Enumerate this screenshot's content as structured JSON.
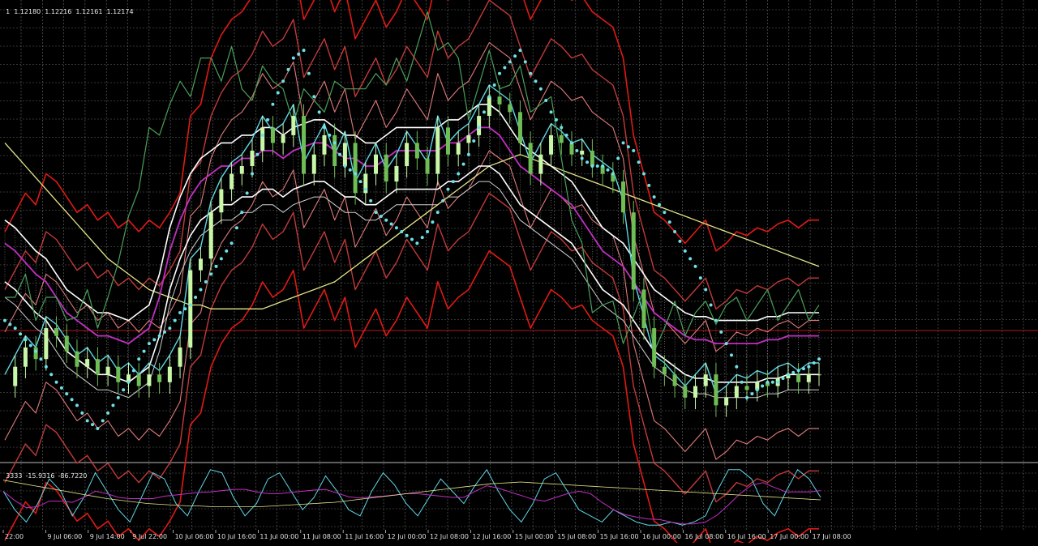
{
  "header": {
    "symbol_mark": "1",
    "ohlc": [
      "1.12180",
      "1.12216",
      "1.12161",
      "1.12174"
    ]
  },
  "oscillator_header": {
    "values": [
      "3333",
      "-15.9316",
      "-86.7220"
    ]
  },
  "colors": {
    "background": "#000000",
    "grid": "#6a6a6a",
    "price_line": "#b01818",
    "separator": "#bbbbbb",
    "candle": "#c9f7a8",
    "candle_dark": "#6fbd55",
    "bb_outer": "#e01a14",
    "bb_mid": "#c23a3a",
    "bb_light": "#e07a7a",
    "white_line": "#ffffff",
    "cyan_line": "#5fd6e6",
    "magenta_line": "#c22ec2",
    "yellow_line": "#e6e68a",
    "green_line": "#4aa05a",
    "psar": "#6fe0e8",
    "gray_line": "#cfcfcf"
  },
  "chart_data": {
    "type": "line",
    "chart_kind": "candlestick with overlay indicators (Bollinger bands, Ichimoku cloud, Parabolic SAR, moving averages) and an oscillator sub-panel",
    "x_tick_labels": [
      "22:00",
      "9 Jul 06:00",
      "9 Jul 14:00",
      "9 Jul 22:00",
      "10 Jul 06:00",
      "10 Jul 16:00",
      "11 Jul 00:00",
      "11 Jul 08:00",
      "11 Jul 16:00",
      "12 Jul 00:00",
      "12 Jul 08:00",
      "12 Jul 16:00",
      "15 Jul 00:00",
      "15 Jul 08:00",
      "15 Jul 16:00",
      "16 Jul 00:00",
      "16 Jul 08:00",
      "16 Jul 16:00",
      "17 Jul 00:00",
      "17 Jul 08:00"
    ],
    "grid": true,
    "x": [
      0,
      2,
      4,
      6,
      8,
      10,
      12,
      14,
      16,
      18,
      20,
      22,
      24,
      26,
      28,
      30,
      32,
      34,
      36,
      38,
      40,
      42,
      44,
      46,
      48,
      50,
      52,
      54,
      56,
      58,
      60,
      62,
      64,
      66,
      68,
      70,
      72,
      74,
      76,
      78,
      80,
      82,
      84,
      86,
      88,
      90,
      92,
      94,
      96,
      98,
      100,
      102,
      104,
      106,
      108,
      110,
      112,
      114,
      116,
      118,
      120,
      122,
      124,
      126,
      128,
      130,
      132,
      134,
      136,
      138,
      140,
      142,
      144,
      146,
      148,
      150,
      152,
      154,
      156,
      158
    ],
    "series": [
      {
        "key": "close",
        "values": [
          15,
          20,
          25,
          22,
          30,
          28,
          24,
          20,
          22,
          18,
          20,
          16,
          18,
          15,
          18,
          16,
          20,
          25,
          45,
          48,
          60,
          66,
          70,
          72,
          76,
          82,
          78,
          80,
          85,
          70,
          75,
          80,
          72,
          78,
          65,
          70,
          75,
          68,
          72,
          78,
          74,
          70,
          82,
          75,
          78,
          80,
          85,
          90,
          88,
          86,
          78,
          70,
          75,
          80,
          78,
          75,
          76,
          72,
          70,
          68,
          60,
          40,
          30,
          20,
          18,
          15,
          12,
          15,
          18,
          10,
          12,
          15,
          14,
          16,
          15,
          17,
          18,
          16,
          18,
          18
        ]
      },
      {
        "key": "psar",
        "values": [
          32,
          30,
          27,
          24,
          20,
          16,
          13,
          10,
          6,
          4,
          8,
          12,
          16,
          22,
          26,
          28,
          30,
          34,
          36,
          40,
          44,
          48,
          52,
          60,
          70,
          80,
          88,
          94,
          100,
          102,
          90,
          82,
          78,
          72,
          70,
          66,
          60,
          58,
          56,
          54,
          52,
          55,
          60,
          66,
          70,
          75,
          82,
          90,
          96,
          99,
          102,
          96,
          92,
          86,
          82,
          78,
          74,
          72,
          72,
          70,
          78,
          76,
          70,
          64,
          60,
          55,
          50,
          46,
          40,
          32,
          26,
          20,
          12,
          14,
          16,
          16,
          18,
          19,
          20,
          22
        ]
      },
      {
        "key": "white_mid",
        "values": [
          50,
          48,
          45,
          42,
          40,
          36,
          32,
          30,
          28,
          26,
          26,
          25,
          24,
          26,
          28,
          36,
          48,
          56,
          62,
          66,
          68,
          70,
          70,
          72,
          72,
          74,
          74,
          72,
          74,
          75,
          76,
          76,
          74,
          72,
          72,
          70,
          70,
          72,
          74,
          74,
          74,
          74,
          74,
          76,
          76,
          78,
          80,
          80,
          78,
          74,
          70,
          68,
          66,
          64,
          62,
          60,
          56,
          52,
          48,
          46,
          44,
          40,
          36,
          32,
          30,
          28,
          26,
          25,
          25,
          24,
          24,
          24,
          24,
          24,
          25,
          25,
          26,
          26,
          26,
          26
        ]
      },
      {
        "key": "sma_yellow",
        "values": [
          78,
          75,
          72,
          69,
          66,
          63,
          60,
          57,
          54,
          51,
          48,
          46,
          44,
          42,
          40,
          39,
          38,
          37,
          36,
          36,
          35,
          35,
          35,
          35,
          35,
          35,
          36,
          37,
          38,
          39,
          40,
          41,
          42,
          44,
          46,
          48,
          50,
          52,
          54,
          56,
          58,
          60,
          62,
          64,
          66,
          68,
          70,
          72,
          73,
          74,
          75,
          74,
          73,
          72,
          71,
          70,
          69,
          68,
          67,
          66,
          65,
          64,
          63,
          62,
          61,
          60,
          59,
          58,
          57,
          56,
          55,
          54,
          53,
          52,
          51,
          50,
          49,
          48,
          47,
          46
        ]
      },
      {
        "key": "oscillator_cyan",
        "values": [
          60,
          30,
          10,
          40,
          80,
          60,
          20,
          50,
          90,
          60,
          30,
          10,
          50,
          90,
          80,
          40,
          20,
          60,
          95,
          90,
          50,
          20,
          40,
          80,
          90,
          60,
          30,
          50,
          85,
          60,
          30,
          20,
          60,
          90,
          70,
          40,
          20,
          50,
          80,
          60,
          40,
          70,
          95,
          60,
          30,
          10,
          40,
          80,
          90,
          60,
          30,
          20,
          10,
          30,
          20,
          10,
          5,
          5,
          10,
          5,
          10,
          20,
          60,
          95,
          95,
          80,
          40,
          20,
          60,
          95,
          80,
          50
        ]
      }
    ],
    "ylim": [
      0,
      110
    ],
    "legend": "none"
  }
}
